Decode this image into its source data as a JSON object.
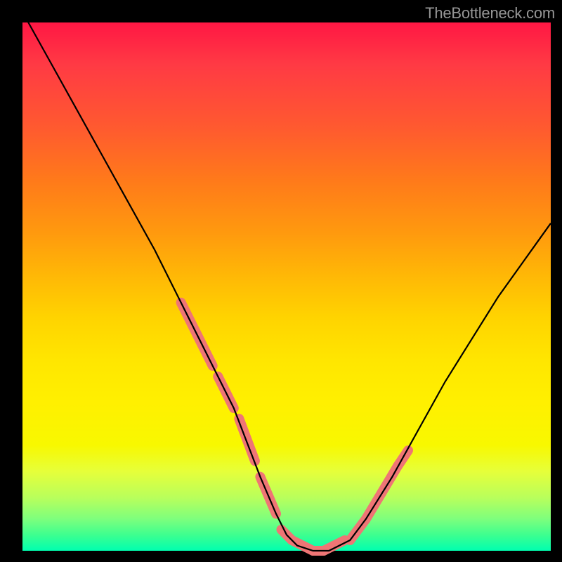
{
  "watermark": "TheBottleneck.com",
  "chart_data": {
    "type": "line",
    "title": "",
    "xlabel": "",
    "ylabel": "",
    "xlim": [
      0,
      100
    ],
    "ylim": [
      0,
      100
    ],
    "legend": false,
    "grid": false,
    "background": "vertical-gradient red→yellow→green",
    "series": [
      {
        "name": "bottleneck-curve",
        "stroke": "#000000",
        "x": [
          0,
          5,
          10,
          15,
          20,
          25,
          30,
          35,
          40,
          45,
          48,
          50,
          52,
          55,
          58,
          60,
          62,
          65,
          70,
          75,
          80,
          85,
          90,
          95,
          100
        ],
        "y": [
          102,
          93,
          84,
          75,
          66,
          57,
          47,
          37,
          27,
          14,
          7,
          3,
          1,
          0,
          0,
          1,
          2,
          6,
          14,
          23,
          32,
          40,
          48,
          55,
          62
        ]
      }
    ],
    "markers": {
      "name": "highlight-segments",
      "stroke": "#ef7575",
      "segments": [
        {
          "x": [
            30,
            33
          ],
          "y": [
            47,
            41
          ]
        },
        {
          "x": [
            33,
            36
          ],
          "y": [
            41,
            35
          ]
        },
        {
          "x": [
            37,
            40
          ],
          "y": [
            33,
            27
          ]
        },
        {
          "x": [
            41,
            44
          ],
          "y": [
            25,
            17
          ]
        },
        {
          "x": [
            45,
            48
          ],
          "y": [
            14,
            7
          ]
        },
        {
          "x": [
            49,
            51
          ],
          "y": [
            4,
            2
          ]
        },
        {
          "x": [
            51,
            53
          ],
          "y": [
            2,
            1
          ]
        },
        {
          "x": [
            53,
            55
          ],
          "y": [
            1,
            0
          ]
        },
        {
          "x": [
            55,
            57
          ],
          "y": [
            0,
            0
          ]
        },
        {
          "x": [
            57,
            59
          ],
          "y": [
            0,
            1
          ]
        },
        {
          "x": [
            59,
            61
          ],
          "y": [
            1,
            2
          ]
        },
        {
          "x": [
            62,
            65
          ],
          "y": [
            2,
            6
          ]
        },
        {
          "x": [
            65,
            68
          ],
          "y": [
            6,
            11
          ]
        },
        {
          "x": [
            68,
            71
          ],
          "y": [
            11,
            16
          ]
        },
        {
          "x": [
            71,
            73
          ],
          "y": [
            16,
            19
          ]
        }
      ]
    }
  }
}
